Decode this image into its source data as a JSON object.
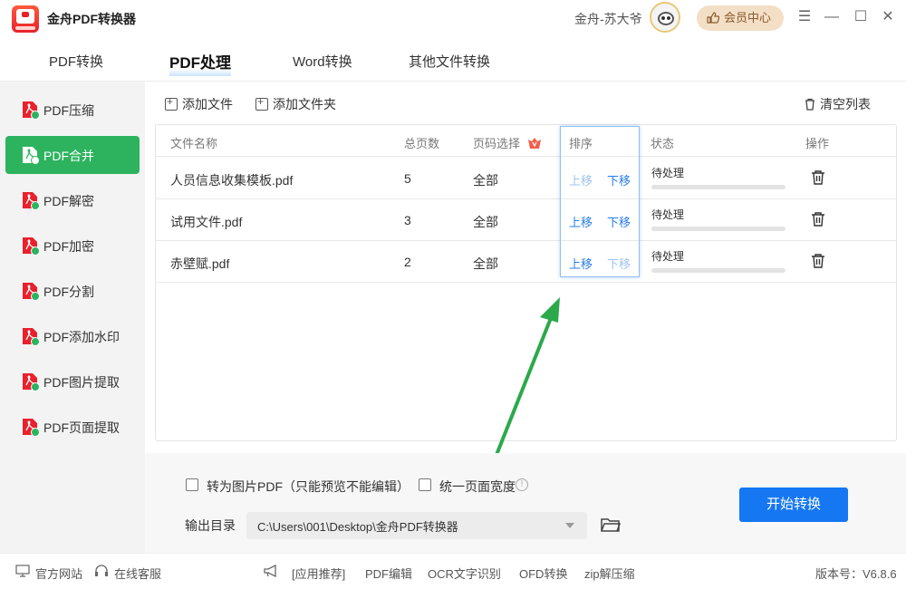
{
  "app": {
    "title": "金舟PDF转换器",
    "user_name": "金舟-苏大爷",
    "vip_label": "会员中心"
  },
  "window_controls": {
    "menu": "☰",
    "minimize": "—",
    "maximize": "☐",
    "close": "✕"
  },
  "tabs": [
    {
      "label": "PDF转换",
      "active": false
    },
    {
      "label": "PDF处理",
      "active": true
    },
    {
      "label": "Word转换",
      "active": false
    },
    {
      "label": "其他文件转换",
      "active": false
    }
  ],
  "sidebar": {
    "items": [
      {
        "label": "PDF压缩",
        "active": false
      },
      {
        "label": "PDF合并",
        "active": true
      },
      {
        "label": "PDF解密",
        "active": false
      },
      {
        "label": "PDF加密",
        "active": false
      },
      {
        "label": "PDF分割",
        "active": false
      },
      {
        "label": "PDF添加水印",
        "active": false
      },
      {
        "label": "PDF图片提取",
        "active": false
      },
      {
        "label": "PDF页面提取",
        "active": false
      }
    ]
  },
  "toolbar": {
    "add_file": "添加文件",
    "add_folder": "添加文件夹",
    "clear_list": "清空列表"
  },
  "table": {
    "headers": {
      "name": "文件名称",
      "pages": "总页数",
      "range": "页码选择",
      "sort": "排序",
      "status": "状态",
      "action": "操作"
    },
    "rows": [
      {
        "name": "人员信息收集模板.pdf",
        "pages": "5",
        "range": "全部",
        "up": "上移",
        "down": "下移",
        "up_enabled": false,
        "down_enabled": true,
        "status": "待处理",
        "progress": 0
      },
      {
        "name": "试用文件.pdf",
        "pages": "3",
        "range": "全部",
        "up": "上移",
        "down": "下移",
        "up_enabled": true,
        "down_enabled": true,
        "status": "待处理",
        "progress": 0
      },
      {
        "name": "赤壁赋.pdf",
        "pages": "2",
        "range": "全部",
        "up": "上移",
        "down": "下移",
        "up_enabled": true,
        "down_enabled": false,
        "status": "待处理",
        "progress": 0
      }
    ]
  },
  "options": {
    "to_image_pdf": {
      "label": "转为图片PDF（只能预览不能编辑）",
      "checked": false
    },
    "unify_width": {
      "label": "统一页面宽度",
      "checked": false
    },
    "output_label": "输出目录",
    "output_path": "C:\\Users\\001\\Desktop\\金舟PDF转换器",
    "start_button": "开始转换"
  },
  "statusbar": {
    "website": "官方网站",
    "support": "在线客服",
    "recommend": "[应用推荐]",
    "links": [
      "PDF编辑",
      "OCR文字识别",
      "OFD转换",
      "zip解压缩"
    ],
    "version": "版本号：V6.8.6"
  },
  "colors": {
    "accent_green": "#2db35e",
    "accent_blue": "#1677f2",
    "pdf_red": "#e8212c",
    "arrow_green": "#2ca94b"
  }
}
